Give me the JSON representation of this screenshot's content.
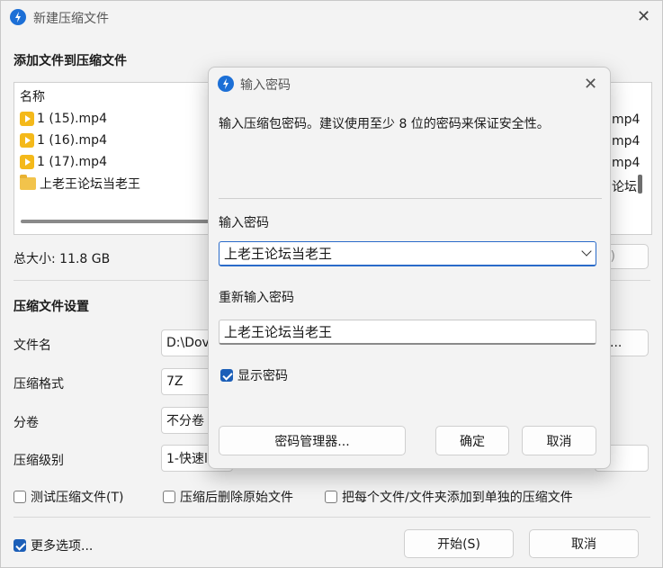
{
  "window": {
    "title": "新建压缩文件"
  },
  "add_section": {
    "heading": "添加文件到压缩文件"
  },
  "file_list": {
    "column_header": "名称",
    "items": [
      {
        "name": "1 (15).mp4",
        "type": "mp4",
        "right_fragment": "mp4"
      },
      {
        "name": "1 (16).mp4",
        "type": "mp4",
        "right_fragment": "mp4"
      },
      {
        "name": "1 (17).mp4",
        "type": "mp4",
        "right_fragment": "mp4"
      },
      {
        "name": "上老王论坛当老王",
        "type": "folder",
        "right_fragment": "论坛"
      }
    ]
  },
  "total_size": "总大小: 11.8 GB",
  "hidden_button_fragment": ")",
  "settings": {
    "heading": "压缩文件设置",
    "filename_label": "文件名",
    "filename_value": "D:\\Dov",
    "browse_fragment": "...",
    "format_label": "压缩格式",
    "format_value": "7Z",
    "split_label": "分卷",
    "split_value": "不分卷",
    "level_label": "压缩级别",
    "level_value": "1-快速l"
  },
  "options": {
    "test": "测试压缩文件(T)",
    "delete_after": "压缩后删除原始文件",
    "each_separate": "把每个文件/文件夹添加到单独的压缩文件",
    "more": "更多选项..."
  },
  "footer": {
    "start": "开始(S)",
    "cancel": "取消"
  },
  "dialog": {
    "title": "输入密码",
    "description": "输入压缩包密码。建议使用至少 8 位的密码来保证安全性。",
    "password_label": "输入密码",
    "password_value": "上老王论坛当老王",
    "reenter_label": "重新输入密码",
    "reenter_value": "上老王论坛当老王",
    "show_password": "显示密码",
    "show_password_checked": true,
    "manager_button": "密码管理器...",
    "ok_button": "确定",
    "cancel_button": "取消"
  },
  "colors": {
    "accent": "#1c5fb8",
    "brand_icon": "#1c6fd6",
    "mp4_icon": "#f4b91a",
    "folder_icon": "#f2c34b"
  }
}
